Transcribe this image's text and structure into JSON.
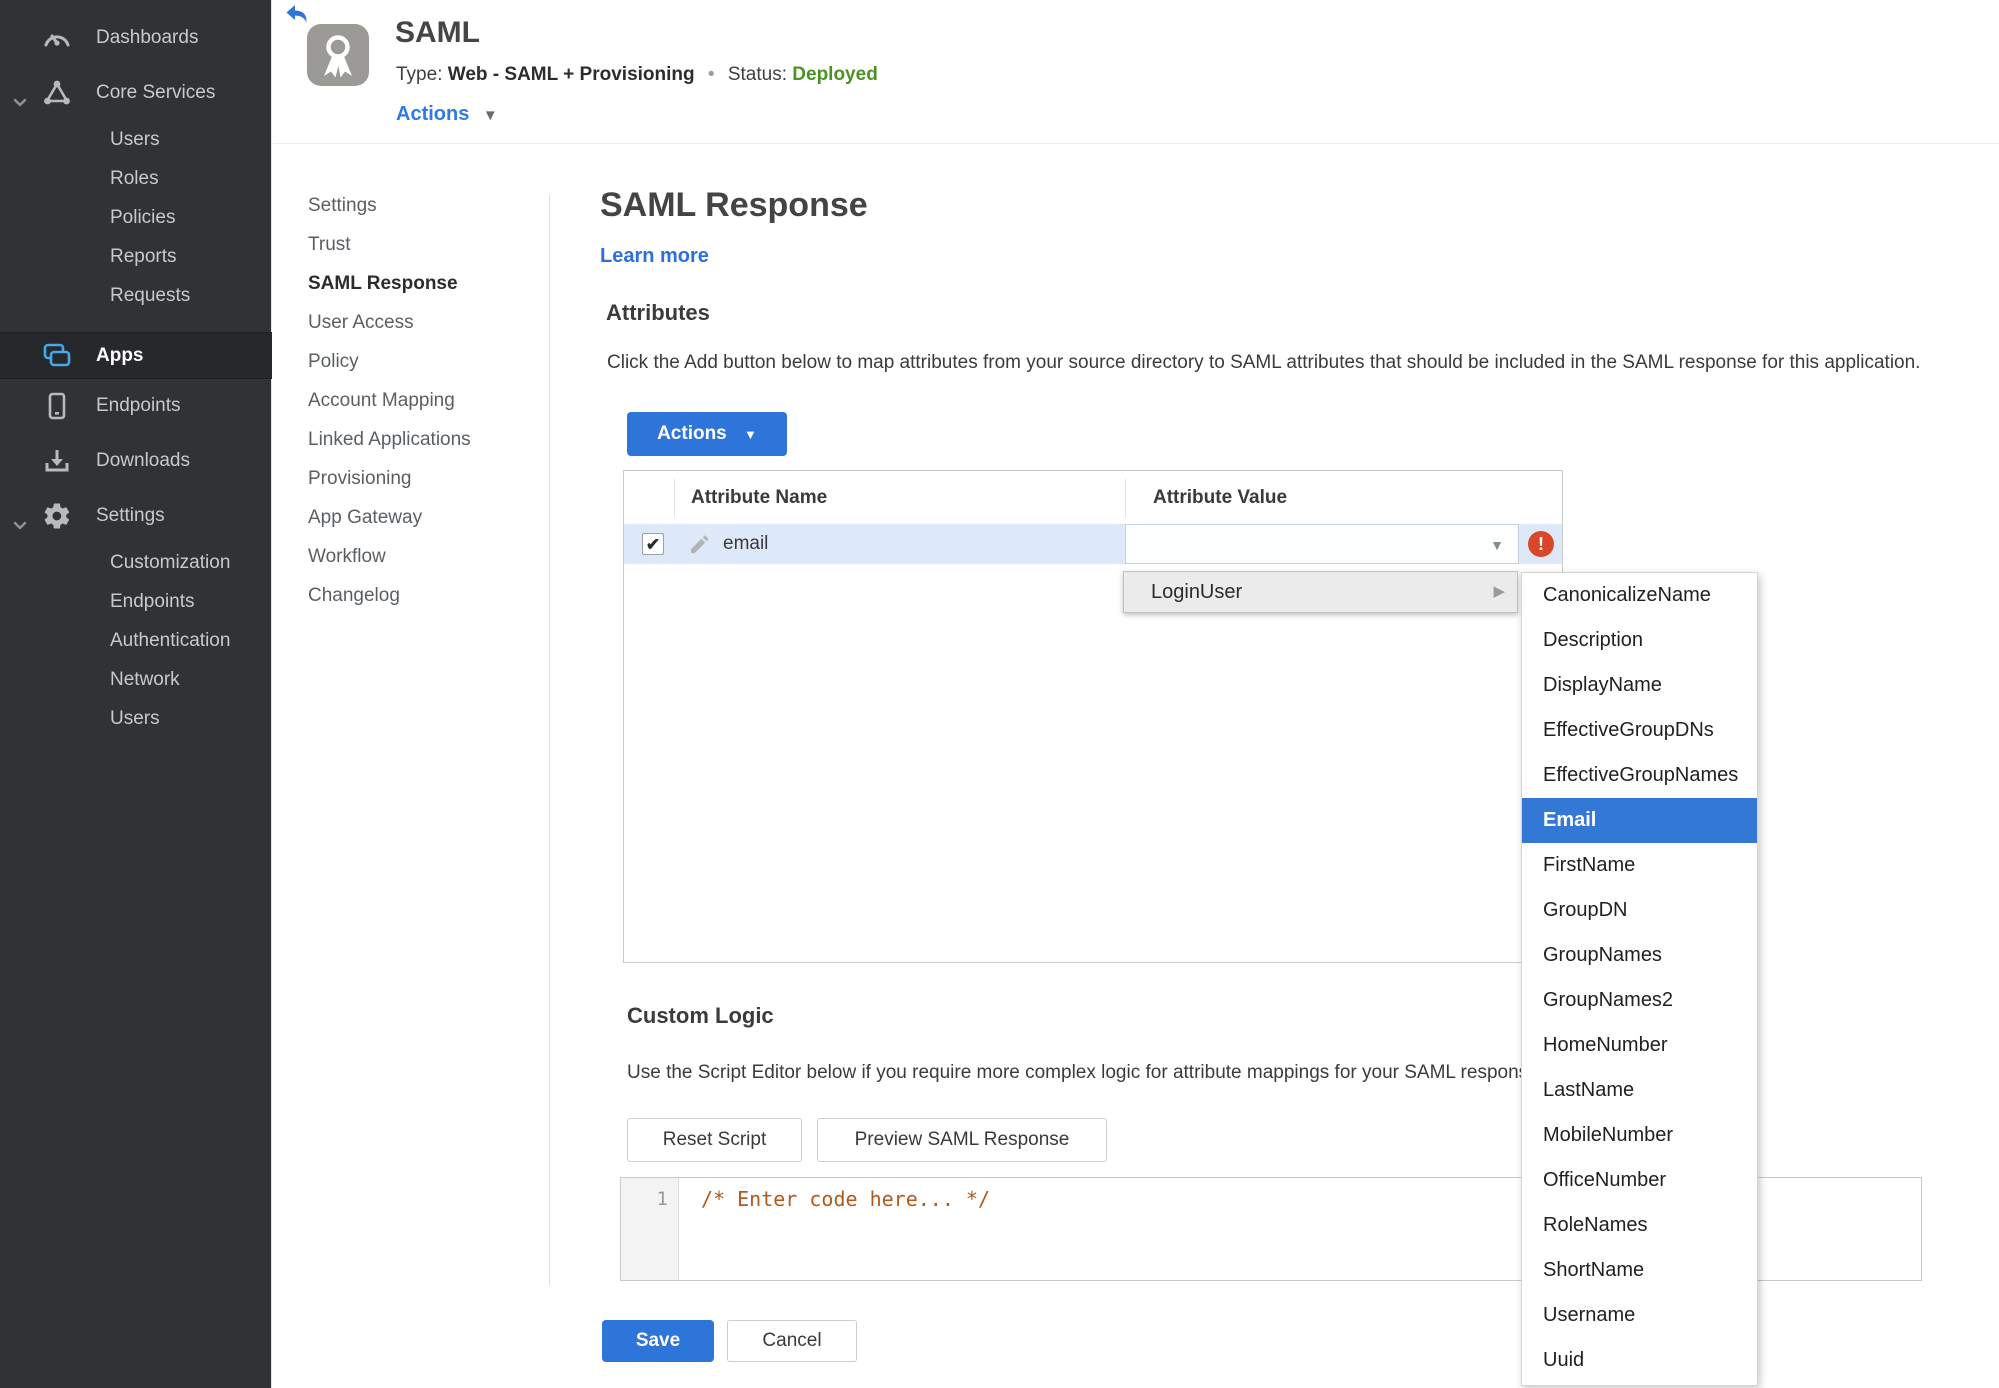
{
  "app": {
    "title": "SAML",
    "type_label": "Type:",
    "type_value": "Web - SAML + Provisioning",
    "separator": "•",
    "status_label": "Status:",
    "status_value": "Deployed",
    "actions_label": "Actions"
  },
  "sidebar": {
    "dashboards": "Dashboards",
    "core_services": {
      "label": "Core Services",
      "items": [
        "Users",
        "Roles",
        "Policies",
        "Reports",
        "Requests"
      ]
    },
    "apps": "Apps",
    "endpoints": "Endpoints",
    "downloads": "Downloads",
    "settings": {
      "label": "Settings",
      "items": [
        "Customization",
        "Endpoints",
        "Authentication",
        "Network",
        "Users"
      ]
    }
  },
  "nav": {
    "items": [
      "Settings",
      "Trust",
      "SAML Response",
      "User Access",
      "Policy",
      "Account Mapping",
      "Linked Applications",
      "Provisioning",
      "App Gateway",
      "Workflow",
      "Changelog"
    ],
    "active": "SAML Response"
  },
  "main": {
    "title": "SAML Response",
    "learn_more": "Learn more",
    "attributes": {
      "heading": "Attributes",
      "description": "Click the Add button below to map attributes from your source directory to SAML attributes that should be included in the SAML response for this application.",
      "actions_button": "Actions"
    },
    "table": {
      "columns": [
        "Attribute Name",
        "Attribute Value"
      ],
      "rows": [
        {
          "name": "email",
          "value": "",
          "checked": true,
          "error": true
        }
      ]
    },
    "value_menu": {
      "label": "LoginUser",
      "items": [
        "CanonicalizeName",
        "Description",
        "DisplayName",
        "EffectiveGroupDNs",
        "EffectiveGroupNames",
        "Email",
        "FirstName",
        "GroupDN",
        "GroupNames",
        "GroupNames2",
        "HomeNumber",
        "LastName",
        "MobileNumber",
        "OfficeNumber",
        "RoleNames",
        "ShortName",
        "Username",
        "Uuid"
      ],
      "selected": "Email"
    },
    "custom_logic": {
      "heading": "Custom Logic",
      "description": "Use the Script Editor below if you require more complex logic for attribute mappings for your SAML response.",
      "reset_button": "Reset Script",
      "preview_button": "Preview SAML Response",
      "editor": {
        "line_number": "1",
        "code": "/* Enter code here... */"
      }
    },
    "save_button": "Save",
    "cancel_button": "Cancel"
  },
  "icons": {
    "sidebar": [
      "dashboard-gauge-icon",
      "core-services-icon",
      "apps-icon",
      "endpoints-phone-icon",
      "downloads-icon",
      "settings-gear-icon"
    ],
    "header": [
      "back-arrow-icon",
      "award-ribbon-icon"
    ],
    "misc": [
      "chevron-down-icon",
      "pencil-icon",
      "caret-down-icon",
      "caret-right-icon",
      "error-exclamation-icon",
      "checkmark-icon"
    ]
  },
  "colors": {
    "accent_blue": "#2e75d9",
    "menu_selected_blue": "#3478d6",
    "status_green": "#4a9222",
    "error_red": "#d9472b",
    "sidebar_bg": "#2f3336",
    "row_highlight": "#dde9f8",
    "apps_icon_cyan": "#47a8e8"
  }
}
